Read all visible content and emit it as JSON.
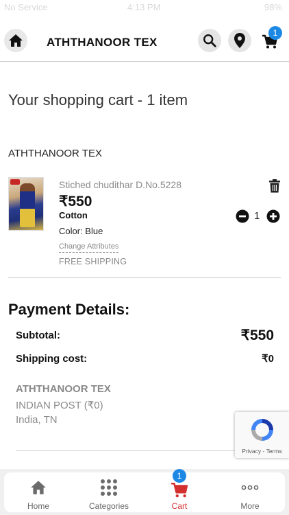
{
  "status_bar": {
    "carrier": "No Service",
    "time": "4:13 PM",
    "battery": "98%"
  },
  "header": {
    "title": "ATHTHANOOR TEX",
    "cart_count": "1"
  },
  "cart": {
    "title": "Your shopping cart - 1 item",
    "store": "ATHTHANOOR TEX",
    "item": {
      "name": "Stiched chudithar D.No.5228",
      "price": "₹550",
      "fabric": "Cotton",
      "color": "Color: Blue",
      "change_attributes": "Change Attributes",
      "shipping": "FREE SHIPPING",
      "quantity": "1"
    }
  },
  "payment": {
    "title": "Payment Details:",
    "subtotal_label": "Subtotal:",
    "subtotal_value": "₹550",
    "shipping_label": "Shipping cost:",
    "shipping_value": "₹0",
    "ship_store": "ATHTHANOOR TEX",
    "ship_method": "INDIAN POST (₹0)",
    "ship_location": "India, TN"
  },
  "recaptcha": {
    "text": "Privacy - Terms"
  },
  "bottom_nav": {
    "home": "Home",
    "categories": "Categories",
    "cart": "Cart",
    "more": "More",
    "cart_badge": "1"
  },
  "colors": {
    "accent_red": "#d32f2f",
    "badge_blue": "#1e88e5"
  }
}
